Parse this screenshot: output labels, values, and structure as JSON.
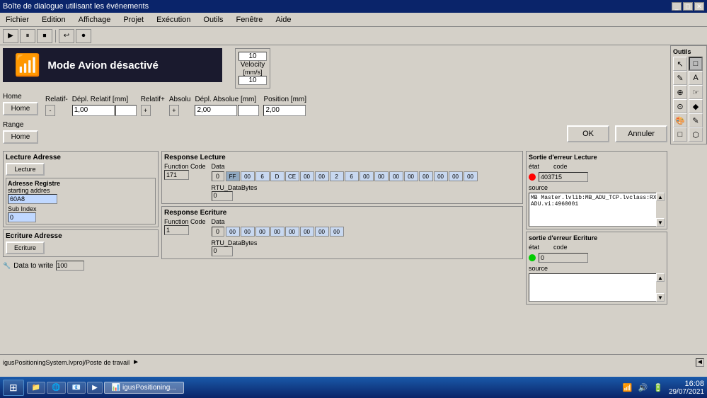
{
  "window": {
    "title": "Boîte de dialogue utilisant les événements",
    "controls": [
      "_",
      "□",
      "✕"
    ]
  },
  "menu": {
    "items": [
      "Fichier",
      "Edition",
      "Affichage",
      "Projet",
      "Exécution",
      "Outils",
      "Fenêtre",
      "Aide"
    ]
  },
  "toolbar": {
    "buttons": [
      "▶",
      "⏸",
      "⏹",
      "↩",
      "⏺"
    ]
  },
  "tools_panel": {
    "title": "Outils",
    "rows": [
      [
        "↖",
        "□"
      ],
      [
        "✎",
        "A"
      ],
      [
        "⊕",
        "☞"
      ],
      [
        "⊙",
        "◆"
      ],
      [
        "🎨",
        "✎"
      ],
      [
        "□",
        "⬡"
      ]
    ]
  },
  "airplane": {
    "icon": "📶",
    "text": "Mode Avion désactivé"
  },
  "velocity": {
    "label1": "10",
    "label2": "Velocity",
    "unit": "[mm/s]",
    "value": "10"
  },
  "controls": {
    "relatif_label": "Relatif-",
    "deplacement_relatif": "Dépl. Relatif [mm]",
    "relatifplus_label": "Relatif+",
    "absolu_label": "Absolu",
    "deplacement_absolu": "Dépl. Absolue [mm]",
    "position_label": "Position [mm]",
    "minus_btn": "-",
    "plus_btn": "+",
    "relatif_value": "1,00",
    "absolu_plus": "+",
    "absolu_value": "2,00",
    "position_value": "2,00"
  },
  "home_range": {
    "home_label": "Home",
    "home_btn": "Home",
    "range_label": "Range",
    "range_btn": "Home"
  },
  "actions": {
    "ok": "OK",
    "cancel": "Annuler"
  },
  "lecture": {
    "title": "Lecture Adresse",
    "btn": "Lecture",
    "sub_title": "Adresse Registre",
    "starting_address": "starting addres",
    "starting_value": "60A8",
    "sub_index_label": "Sub Index",
    "sub_index_value": "0",
    "data_to_write": "Data to write",
    "write_value": "100"
  },
  "response_lecture": {
    "title": "Response Lecture",
    "function_code_label": "Function Code",
    "function_code_value": "171",
    "data_label": "Data",
    "data_index": "0",
    "data_bytes": [
      "FF",
      "00",
      "6",
      "D",
      "CE",
      "00",
      "00",
      "2",
      "6"
    ],
    "data_extra": [
      "00",
      "00",
      "00",
      "00",
      "00",
      "00",
      "00",
      "00",
      "00"
    ],
    "rtu_label": "RTU_DataBytes",
    "rtu_value": "0"
  },
  "response_ecriture": {
    "title": "Response Ecriture",
    "function_code_label": "Function Code",
    "function_code_value": "1",
    "data_label": "Data",
    "data_index": "0",
    "data_bytes": [
      "00",
      "00",
      "00",
      "00",
      "00",
      "00",
      "00",
      "00"
    ],
    "rtu_label": "RTU_DataBytes",
    "rtu_value": "0"
  },
  "ecriture": {
    "title": "Ecriture Adresse",
    "btn": "Ecriture"
  },
  "sortie_erreur_lecture": {
    "title": "Sortie d'erreur Lecture",
    "etat_label": "état",
    "code_label": "code",
    "indicator": "red",
    "code_value": "403715",
    "source_label": "source",
    "source_text": "MB Master.lvlib:MB_ADU_TCP.lvclass:RX ADU.vi:4960001"
  },
  "sortie_erreur_ecriture": {
    "title": "sortie d'erreur Ecriture",
    "etat_label": "état",
    "code_label": "code",
    "indicator": "green",
    "code_value": "0",
    "source_label": "source",
    "source_text": ""
  },
  "taskbar": {
    "path": "igusPositioningSystem.lvproj/Poste de travail",
    "arrow": "►"
  },
  "win_taskbar": {
    "start": "⊞",
    "apps": [
      "📁",
      "🌐",
      "📧",
      "▶"
    ],
    "time": "16:08",
    "date": "29/07/2021"
  }
}
